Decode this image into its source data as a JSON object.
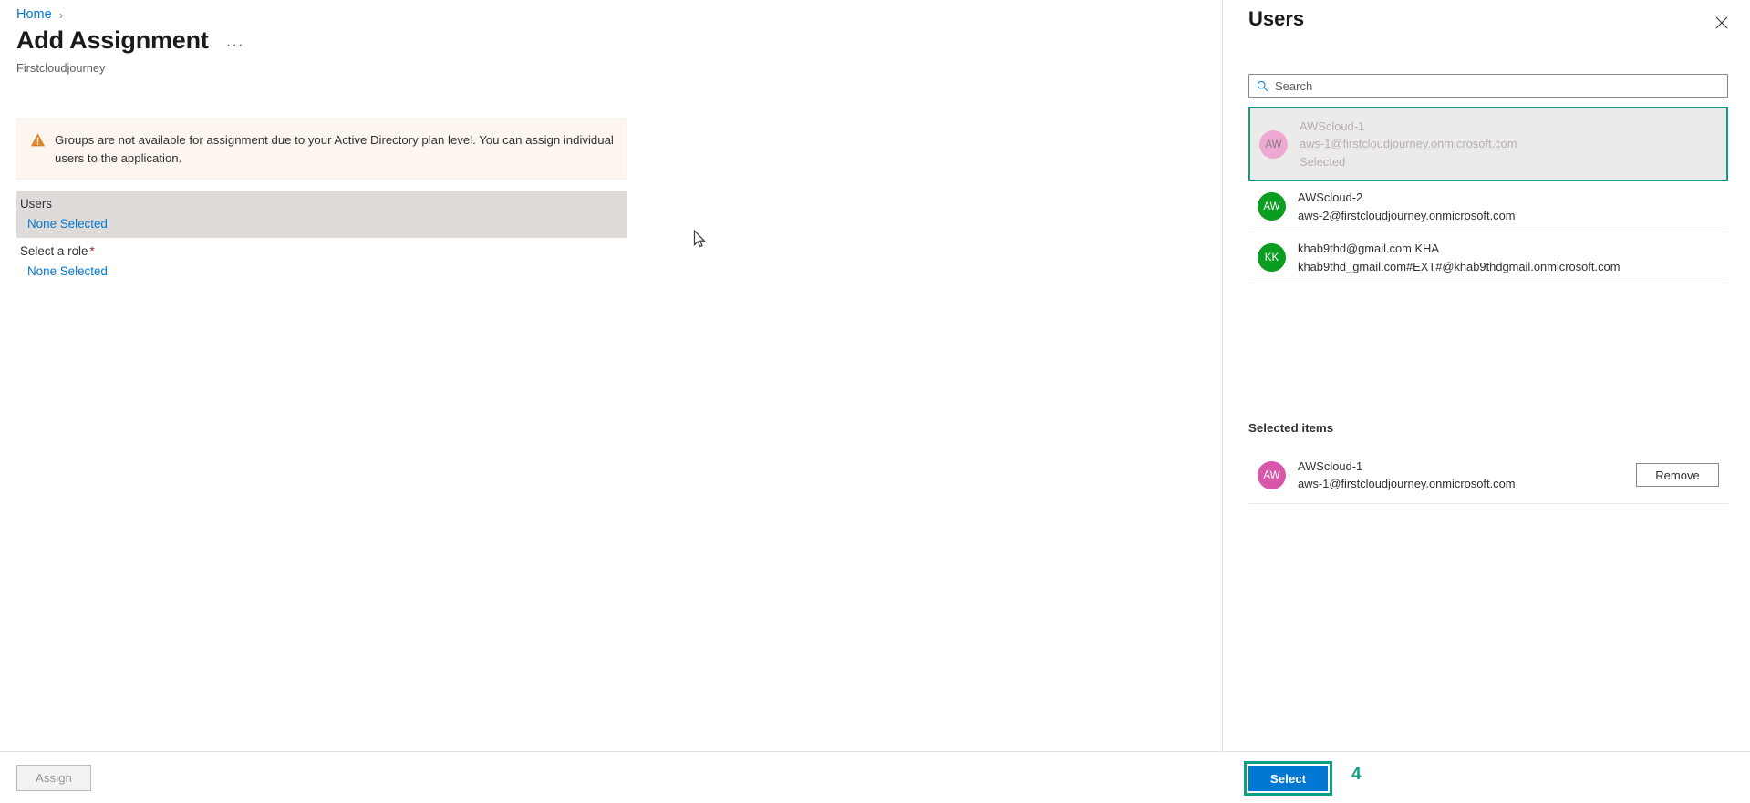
{
  "breadcrumb": {
    "home_label": "Home",
    "separator": "›"
  },
  "page": {
    "title": "Add Assignment",
    "subtitle": "Firstcloudjourney",
    "more_label": "···"
  },
  "warning": {
    "icon": "warning-triangle-icon",
    "text": "Groups are not available for assignment due to your Active Directory plan level. You can assign individual users to the application."
  },
  "form": {
    "users_label": "Users",
    "users_value": "None Selected",
    "role_label": "Select a role",
    "role_required_marker": "*",
    "role_value": "None Selected"
  },
  "footer": {
    "assign_label": "Assign"
  },
  "panel": {
    "title": "Users",
    "close_icon": "close-icon",
    "search": {
      "placeholder": "Search",
      "value": "",
      "icon": "search-icon"
    },
    "users": [
      {
        "name": "AWScloud-1",
        "email": "aws-1@firstcloudjourney.onmicrosoft.com",
        "state": "Selected",
        "initials": "AW",
        "avatar_color": "#eda8d3",
        "selected": true
      },
      {
        "name": "AWScloud-2",
        "email": "aws-2@firstcloudjourney.onmicrosoft.com",
        "state": "",
        "initials": "AW",
        "avatar_color": "#0b9d1f",
        "selected": false
      },
      {
        "name": "khab9thd@gmail.com KHA",
        "email": "khab9thd_gmail.com#EXT#@khab9thdgmail.onmicrosoft.com",
        "state": "",
        "initials": "KK",
        "avatar_color": "#0b9d1f",
        "selected": false
      }
    ],
    "selected_items_title": "Selected items",
    "selected_items": [
      {
        "name": "AWScloud-1",
        "email": "aws-1@firstcloudjourney.onmicrosoft.com",
        "initials": "AW",
        "avatar_color": "#d957ab",
        "remove_label": "Remove"
      }
    ],
    "footer": {
      "select_label": "Select",
      "step_number": "4"
    }
  },
  "colors": {
    "accent_blue": "#0078d4",
    "highlight_teal": "#0f9e83",
    "warning_orange": "#d9832b",
    "required_red": "#a4262c"
  }
}
